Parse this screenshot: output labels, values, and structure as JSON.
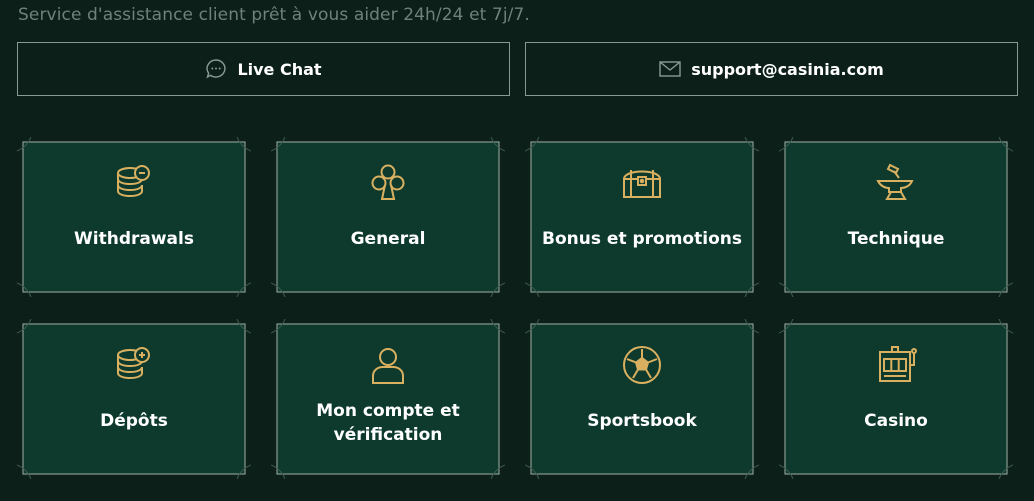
{
  "subtitle": "Service d'assistance client prêt à vous aider 24h/24 et 7j/7.",
  "contacts": {
    "chat": {
      "label": "Live Chat",
      "icon": "chat-bubble-icon"
    },
    "email": {
      "label": "support@casinia.com",
      "icon": "envelope-icon"
    }
  },
  "categories": [
    {
      "label": "Withdrawals",
      "icon": "coin-stack-minus-icon"
    },
    {
      "label": "General",
      "icon": "club-suit-icon"
    },
    {
      "label": "Bonus et promotions",
      "icon": "treasure-chest-icon"
    },
    {
      "label": "Technique",
      "icon": "anvil-hammer-icon"
    },
    {
      "label": "Dépôts",
      "icon": "coin-stack-plus-icon"
    },
    {
      "label_line1": "Mon compte et",
      "label_line2": "vérification",
      "icon": "user-icon"
    },
    {
      "label": "Sportsbook",
      "icon": "soccer-ball-icon"
    },
    {
      "label": "Casino",
      "icon": "slot-machine-icon"
    }
  ],
  "colors": {
    "background": "#0c2019",
    "card": "#0e3a2d",
    "frame": "#8a9a92",
    "icon_gold": "#d9b060",
    "subtitle": "#6f817a"
  }
}
